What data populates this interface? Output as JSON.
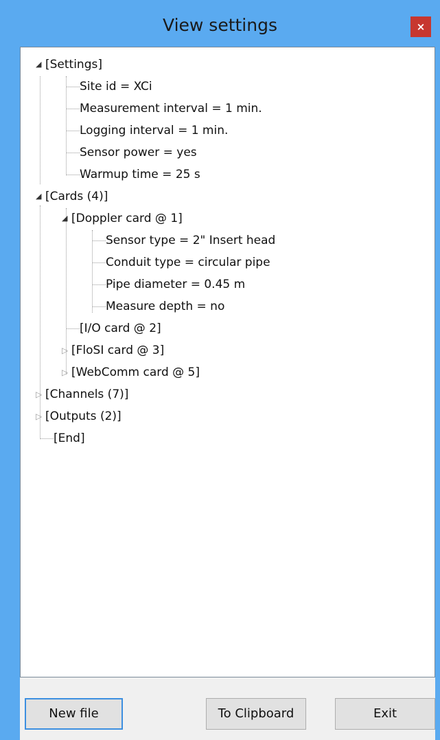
{
  "window": {
    "title": "View settings",
    "close_label": "×"
  },
  "tree": {
    "settings": {
      "label": "[Settings]",
      "items": [
        "Site id = XCi",
        "Measurement interval = 1 min.",
        "Logging interval = 1 min.",
        "Sensor power = yes",
        "Warmup time = 25 s"
      ]
    },
    "cards": {
      "label": "[Cards (4)]",
      "doppler": {
        "label": "[Doppler card @ 1]",
        "items": [
          "Sensor type = 2\" Insert head",
          "Conduit type = circular pipe",
          "Pipe diameter = 0.45 m",
          "Measure depth = no"
        ]
      },
      "io": {
        "label": "[I/O card @ 2]"
      },
      "flosi": {
        "label": "[FloSI card @ 3]"
      },
      "webcomm": {
        "label": "[WebComm card @ 5]"
      }
    },
    "channels": {
      "label": "[Channels (7)]"
    },
    "outputs": {
      "label": "[Outputs (2)]"
    },
    "end": {
      "label": "[End]"
    }
  },
  "buttons": {
    "new_file": "New file",
    "to_clipboard": "To Clipboard",
    "exit": "Exit"
  },
  "colors": {
    "title_bar": "#5aaaf0",
    "close_button": "#c7372f",
    "panel_border": "#7a8a99",
    "default_button_border": "#3c8fe0"
  }
}
